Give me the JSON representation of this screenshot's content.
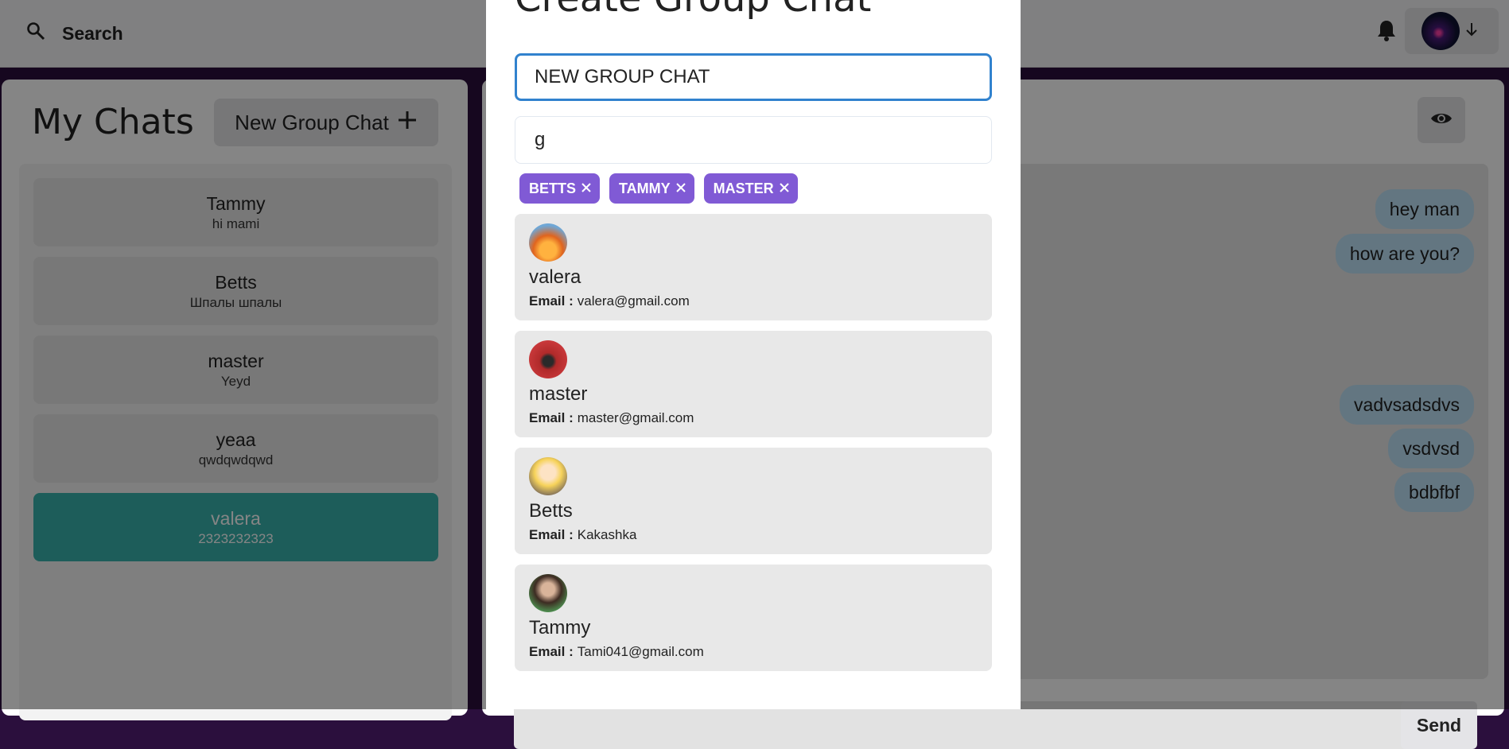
{
  "topbar": {
    "search_label": "Search"
  },
  "sidebar": {
    "title": "My Chats",
    "new_group_label": "New Group Chat",
    "chats": [
      {
        "name": "Tammy",
        "preview": "hi mami"
      },
      {
        "name": "Betts",
        "preview": "Шпалы шпалы"
      },
      {
        "name": "master",
        "preview": "Yeyd"
      },
      {
        "name": "yeaa",
        "preview": "qwdqwdqwd"
      },
      {
        "name": "valera",
        "preview": "2323232323"
      }
    ]
  },
  "chat": {
    "messages": [
      "hey man",
      "how are you?",
      "vadvsadsdvs",
      "vsdvsd",
      "bdbfbf"
    ],
    "send_label": "Send"
  },
  "modal": {
    "title": "Create Group Chat",
    "chat_name_value": "NEW GROUP CHAT",
    "search_value": "g",
    "selected_users": [
      "BETTS",
      "TAMMY",
      "MASTER"
    ],
    "email_label": "Email :",
    "results": [
      {
        "name": "valera",
        "email": "valera@gmail.com"
      },
      {
        "name": "master",
        "email": "master@gmail.com"
      },
      {
        "name": "Betts",
        "email": "Kakashka"
      },
      {
        "name": "Tammy",
        "email": "Tami041@gmail.com"
      }
    ]
  },
  "colors": {
    "accent_purple": "#805ad5",
    "active_chat": "#38b2ac",
    "bubble": "#bee3f8",
    "focus_border": "#3182ce"
  }
}
